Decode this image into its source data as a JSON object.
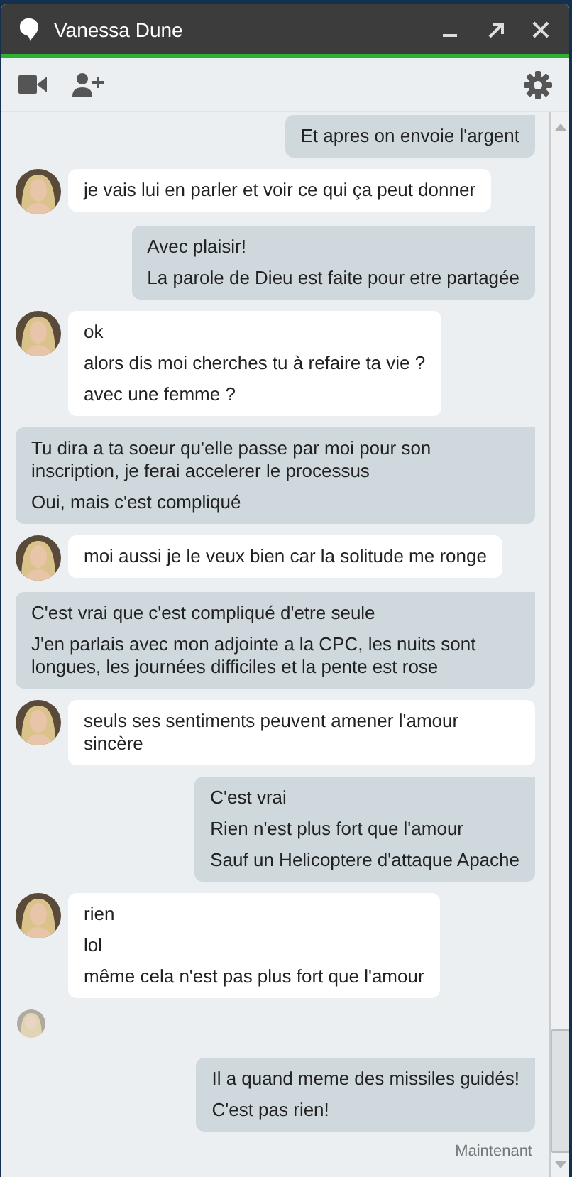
{
  "window": {
    "title": "Vanessa Dune"
  },
  "messages": [
    {
      "kind": "outgoing",
      "lines": [
        "Et apres on envoie l'argent"
      ]
    },
    {
      "kind": "incoming",
      "lines": [
        "je vais lui en parler et voir ce qui ça peut donner"
      ]
    },
    {
      "kind": "outgoing",
      "lines": [
        "Avec plaisir!",
        "La parole de Dieu est faite pour etre partagée"
      ]
    },
    {
      "kind": "incoming",
      "lines": [
        "ok",
        "alors dis moi cherches tu à refaire ta vie ?",
        "avec une femme ?"
      ]
    },
    {
      "kind": "outgoing",
      "lines": [
        "Tu dira a ta soeur qu'elle passe par moi pour son inscription, je ferai accelerer le processus",
        "Oui, mais c'est compliqué"
      ]
    },
    {
      "kind": "incoming",
      "lines": [
        "moi aussi je le veux bien car la solitude me ronge"
      ]
    },
    {
      "kind": "outgoing",
      "lines": [
        "C'est vrai que c'est compliqué d'etre seule",
        "J'en parlais avec mon adjointe a la CPC, les nuits sont longues, les journées difficiles et la pente est rose"
      ]
    },
    {
      "kind": "incoming",
      "lines": [
        "seuls ses sentiments peuvent amener l'amour sincère"
      ]
    },
    {
      "kind": "outgoing",
      "lines": [
        "C'est vrai",
        "Rien n'est plus fort que l'amour",
        "Sauf un Helicoptere d'attaque Apache"
      ]
    },
    {
      "kind": "incoming",
      "lines": [
        "rien",
        "lol",
        "même cela n'est pas plus fort que l'amour"
      ]
    },
    {
      "kind": "seen"
    },
    {
      "kind": "outgoing",
      "lines": [
        "Il a quand meme des missiles guidés!",
        "C'est pas rien!"
      ]
    }
  ],
  "timestamp": "Maintenant"
}
